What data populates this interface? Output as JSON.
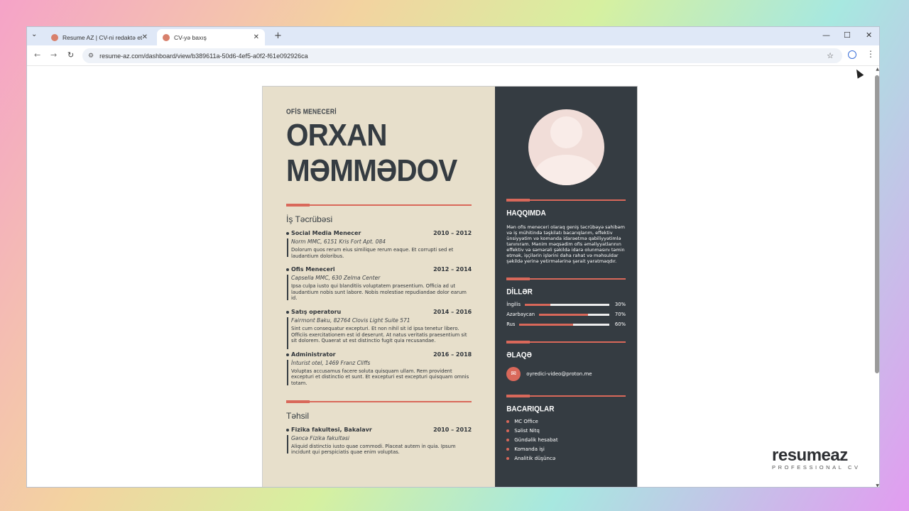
{
  "browser": {
    "tabs": [
      {
        "title": "Resume AZ | CV-ni redaktə et",
        "active": false
      },
      {
        "title": "CV-yə baxış",
        "active": true
      }
    ],
    "url": "resume-az.com/dashboard/view/b389611a-50d6-4ef5-a0f2-f61e092926ca"
  },
  "cv": {
    "role": "OFİS MENECERİ",
    "first_name": "ORXAN",
    "last_name": "MƏMMƏDOV",
    "experience_title": "İş Təcrübəsi",
    "jobs": [
      {
        "title": "Social Media Menecer",
        "years": "2010 – 2012",
        "org": "Norm MMC, 6151 Kris Fort Apt. 084",
        "desc": "Dolorum quos rerum eius similique rerum eaque. Et corrupti sed et laudantium doloribus."
      },
      {
        "title": "Ofis Meneceri",
        "years": "2012 – 2014",
        "org": "Capsella MMC, 630 Zelma Center",
        "desc": "Ipsa culpa iusto qui blanditiis voluptatem praesentium. Officia ad ut laudantium nobis sunt labore. Nobis molestiae repudiandae dolor earum id."
      },
      {
        "title": "Satış operatoru",
        "years": "2014 – 2016",
        "org": "Fairmont Baku, 82764 Clovis Light Suite 571",
        "desc": "Sint cum consequatur excepturi. Et non nihil sit id ipsa tenetur libero. Officiis exercitationem est id deserunt. At natus veritatis praesentium sit sit dolorem. Quaerat ut est distinctio fugit quia recusandae."
      },
      {
        "title": "Administrator",
        "years": "2016 – 2018",
        "org": "İnturist otel, 1469 Franz Cliffs",
        "desc": "Voluptas accusamus facere soluta quisquam ullam. Rem provident excepturi et distinctio et sunt. Et excepturi est excepturi quisquam omnis totam."
      }
    ],
    "education_title": "Təhsil",
    "education": [
      {
        "title": "Fizika fakultəsi, Bakalavr",
        "years": "2010 – 2012",
        "org": "Gəncə Fizika fakultəsi",
        "desc": "Aliquid distinctio iusto quae commodi. Placeat autem in quia. Ipsum incidunt qui perspiciatis quae enim voluptas."
      }
    ],
    "about_title": "HAQQIMDA",
    "about": "Mən ofis meneceri olaraq geniş təcrübəyə sahibəm və iş mühitində təşkilatı bacarıqlarım, effektiv ünsiyyətim və komanda idarəetmə qabiliyyətimlə tanınıram. Mənim məqsədim ofis əməliyyatlarının effektiv və səmərəli şəkildə idarə olunmasını təmin etmək, işçilərin işlərini daha rahat və məhsuldar şəkildə yerinə yetirmələrinə şərait yaratmaqdır.",
    "languages_title": "DİLLƏR",
    "languages": [
      {
        "name": "İngilis",
        "pct_label": "30%",
        "pct": 30
      },
      {
        "name": "Azərbaycan",
        "pct_label": "70%",
        "pct": 70
      },
      {
        "name": "Rus",
        "pct_label": "60%",
        "pct": 60
      }
    ],
    "contact_title": "ƏLAQƏ",
    "email": "oyredici-video@proton.me",
    "skills_title": "BACARIQLAR",
    "skills": [
      "MC Office",
      "Səlist Nitq",
      "Gündəlik hesabat",
      "Komanda işi",
      "Analitik düşüncə"
    ]
  },
  "logo": {
    "word": "resume",
    "word_az": "az",
    "tagline": "PROFESSIONAL CV"
  },
  "colors": {
    "accent": "#d9685a",
    "sidebar": "#353c42",
    "paper": "#e7dfcb"
  }
}
